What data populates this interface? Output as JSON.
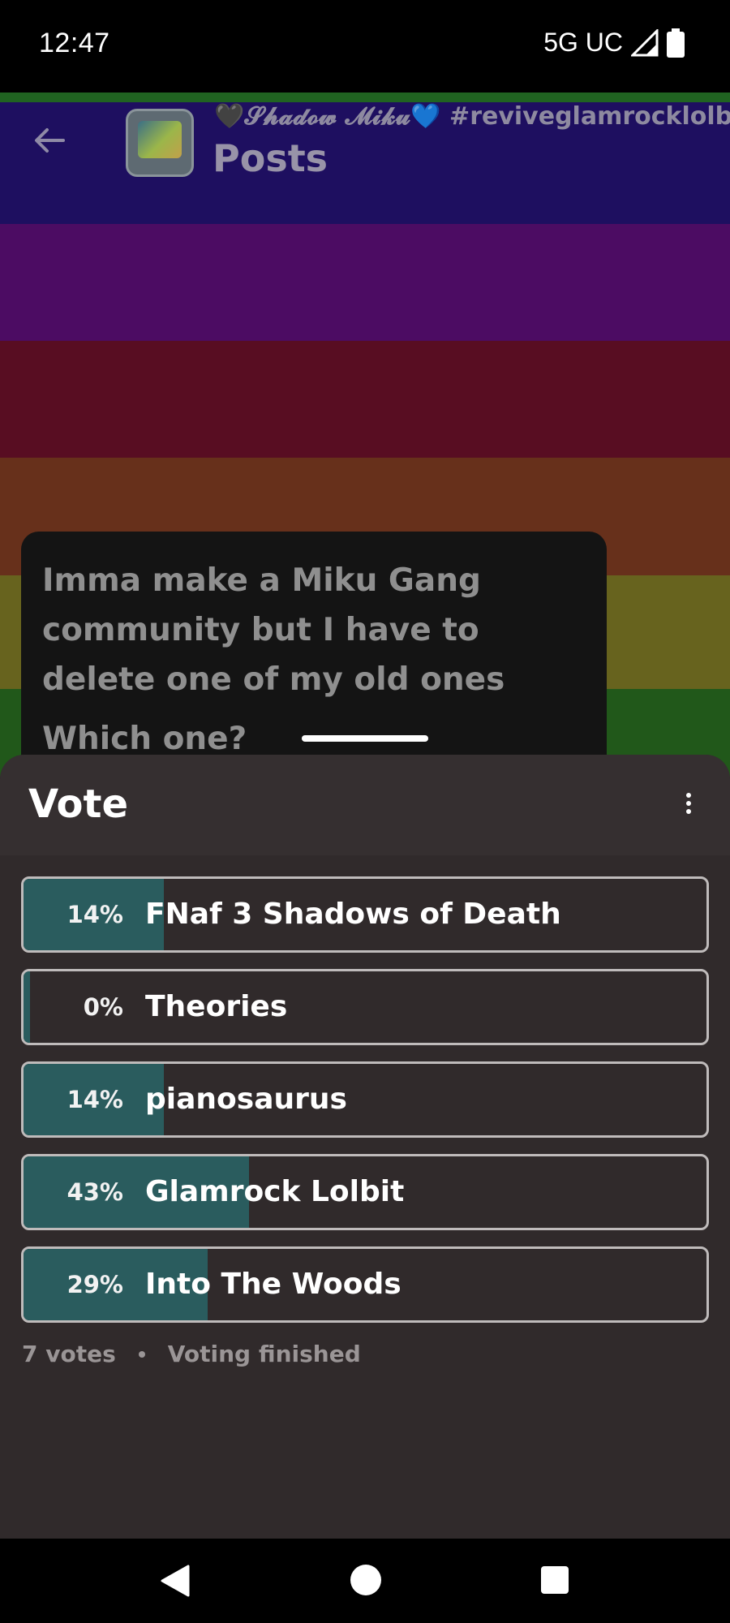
{
  "status_bar": {
    "time": "12:47",
    "network": "5G UC",
    "icons": [
      "signal-icon",
      "battery-icon"
    ]
  },
  "background": {
    "stripe_colors": [
      "#2d8a2f",
      "#2a1585",
      "#6a118a",
      "#7a1230",
      "#8f4326",
      "#8f8a2a",
      "#2e7a24"
    ]
  },
  "app_bar": {
    "back_icon": "back-arrow-icon",
    "subtitle": "🖤𝓢𝓱𝓪𝓭𝓸𝔀 𝓜𝓲𝓴𝓾💙 #reviveglamrocklolbit #W",
    "title": "Posts"
  },
  "post": {
    "text": "Imma make a Miku Gang community but I have to delete one of my old ones",
    "question": "Which one?"
  },
  "vote_sheet": {
    "title": "Vote",
    "menu_icon": "more-vert-icon",
    "accent_color": "#2a5c5e",
    "options": [
      {
        "percent_label": "14%",
        "fraction": 0.14,
        "label": "FNaf 3 Shadows of Death"
      },
      {
        "percent_label": "0%",
        "fraction": 0.0,
        "label": "Theories"
      },
      {
        "percent_label": "14%",
        "fraction": 0.14,
        "label": "pianosaurus"
      },
      {
        "percent_label": "43%",
        "fraction": 0.43,
        "label": "Glamrock Lolbit"
      },
      {
        "percent_label": "29%",
        "fraction": 0.29,
        "label": "Into The Woods"
      }
    ],
    "votes": "7 votes",
    "status": "Voting finished"
  },
  "nav_bar": {
    "icons": [
      "nav-back-icon",
      "nav-home-icon",
      "nav-recents-icon"
    ]
  }
}
